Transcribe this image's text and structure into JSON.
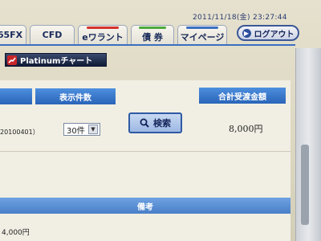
{
  "header": {
    "datetime": "2011/11/18(金) 23:27:44",
    "logout_label": "ログアウト"
  },
  "tabs": [
    {
      "label": "65FX",
      "accent": "#3a6fc0"
    },
    {
      "label": "CFD",
      "accent": "#3a6fc0"
    },
    {
      "label": "eワラント",
      "accent": "#d2332c"
    },
    {
      "label": "債 券",
      "accent": "#4caa3c"
    },
    {
      "label": "マイページ",
      "accent": "#3a6fc0"
    }
  ],
  "platinum_button": {
    "label": "Platinumチャート"
  },
  "table": {
    "col_display_count": "表示件数",
    "col_total_amount": "合計受渡金額",
    "col_remarks": "備考"
  },
  "filter": {
    "date_fragment": "20100401）",
    "count_select_value": "30件",
    "search_label": "検索"
  },
  "results": {
    "total_amount": "8,000円",
    "row_amount": "4,000円"
  },
  "colors": {
    "accent_blue": "#2a64b8",
    "nav_blue": "#3a6fc0",
    "logout_border": "#3b5898"
  }
}
